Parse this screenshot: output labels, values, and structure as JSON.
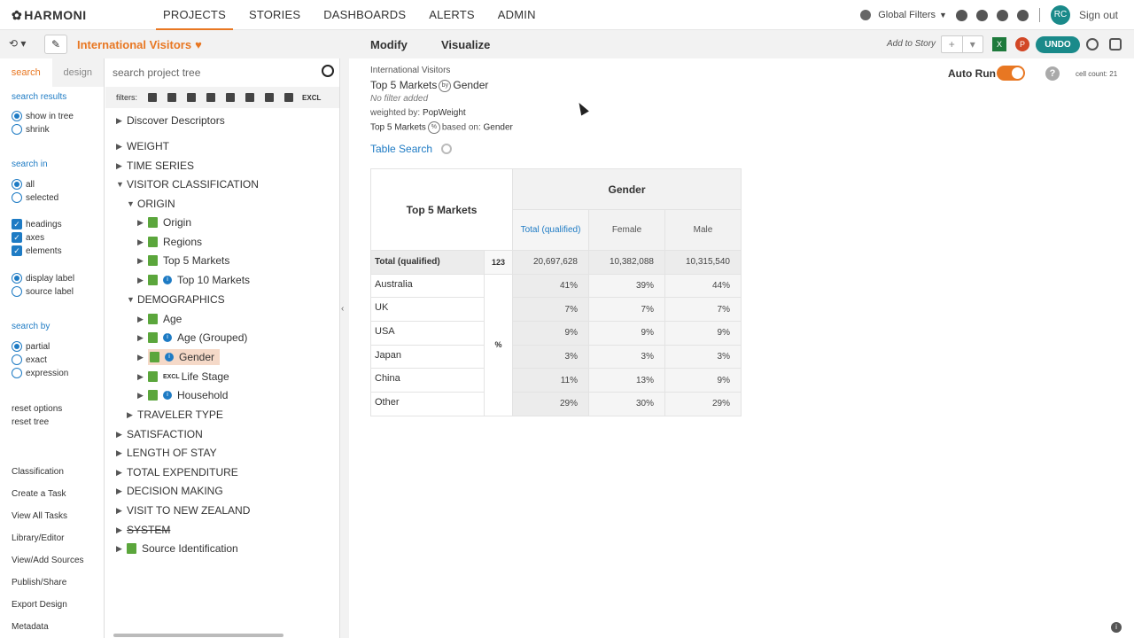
{
  "app": {
    "logo": "HARMONI"
  },
  "nav": [
    "PROJECTS",
    "STORIES",
    "DASHBOARDS",
    "ALERTS",
    "ADMIN"
  ],
  "topright": {
    "global_filters": "Global Filters",
    "avatar": "RC",
    "signout": "Sign out"
  },
  "project": {
    "title": "International Visitors"
  },
  "side": {
    "tab_search": "search",
    "tab_design": "design",
    "search_results": "search results",
    "show_in_tree": "show in tree",
    "shrink": "shrink",
    "search_in": "search in",
    "all": "all",
    "selected": "selected",
    "headings": "headings",
    "axes": "axes",
    "elements": "elements",
    "display_label": "display label",
    "source_label": "source label",
    "search_by": "search by",
    "partial": "partial",
    "exact": "exact",
    "expression": "expression",
    "reset_options": "reset options",
    "reset_tree": "reset tree",
    "links": [
      "Classification",
      "Create a Task",
      "View All Tasks",
      "Library/Editor",
      "View/Add Sources",
      "Publish/Share",
      "Export Design",
      "Metadata"
    ]
  },
  "search": {
    "placeholder": "search project tree"
  },
  "filters": {
    "label": "filters:",
    "excl": "EXCL"
  },
  "tree": {
    "discover": "Discover Descriptors",
    "weight": "WEIGHT",
    "time_series": "TIME SERIES",
    "visitor_class": "VISITOR CLASSIFICATION",
    "origin_group": "ORIGIN",
    "origin": "Origin",
    "regions": "Regions",
    "top5": "Top 5 Markets",
    "top10": "Top 10 Markets",
    "demographics": "DEMOGRAPHICS",
    "age": "Age",
    "age_grouped": "Age (Grouped)",
    "gender": "Gender",
    "life_stage": "Life Stage",
    "life_stage_tag": "EXCL",
    "household": "Household",
    "traveler_type": "TRAVELER TYPE",
    "satisfaction": "SATISFACTION",
    "length_of_stay": "LENGTH OF STAY",
    "total_exp": "TOTAL EXPENDITURE",
    "decision": "DECISION MAKING",
    "visit_nz": "VISIT TO NEW ZEALAND",
    "system": "SYSTEM",
    "source_id": "Source Identification"
  },
  "right": {
    "tab_modify": "Modify",
    "tab_visualize": "Visualize",
    "add_to_story": "Add to Story",
    "undo": "UNDO",
    "xl": "X",
    "pp": "P",
    "meta_project": "International Visitors",
    "meta_row": "Top 5 Markets",
    "by": "by",
    "meta_col": "Gender",
    "no_filter": "No filter added",
    "weighted_by_label": "weighted by:",
    "weighted_by": "PopWeight",
    "pct_row": "Top 5 Markets",
    "pct": "%",
    "based_on_label": "based on:",
    "based_on": "Gender",
    "auto_run": "Auto Run",
    "cell_count": "cell count: 21",
    "table_search": "Table Search"
  },
  "table": {
    "row_header": "Top 5 Markets",
    "col_group": "Gender",
    "columns": [
      "Total (qualified)",
      "Female",
      "Male"
    ],
    "total_label": "Total (qualified)",
    "total_unit": "123",
    "totals": [
      "20,697,628",
      "10,382,088",
      "10,315,540"
    ],
    "pct_unit": "%",
    "rows": [
      {
        "label": "Australia",
        "values": [
          "41%",
          "39%",
          "44%"
        ]
      },
      {
        "label": "UK",
        "values": [
          "7%",
          "7%",
          "7%"
        ]
      },
      {
        "label": "USA",
        "values": [
          "9%",
          "9%",
          "9%"
        ]
      },
      {
        "label": "Japan",
        "values": [
          "3%",
          "3%",
          "3%"
        ]
      },
      {
        "label": "China",
        "values": [
          "11%",
          "13%",
          "9%"
        ]
      },
      {
        "label": "Other",
        "values": [
          "29%",
          "30%",
          "29%"
        ]
      }
    ]
  },
  "colors": {
    "accent": "#e87722",
    "link": "#1e7bc4",
    "undo": "#1a8a8a"
  }
}
